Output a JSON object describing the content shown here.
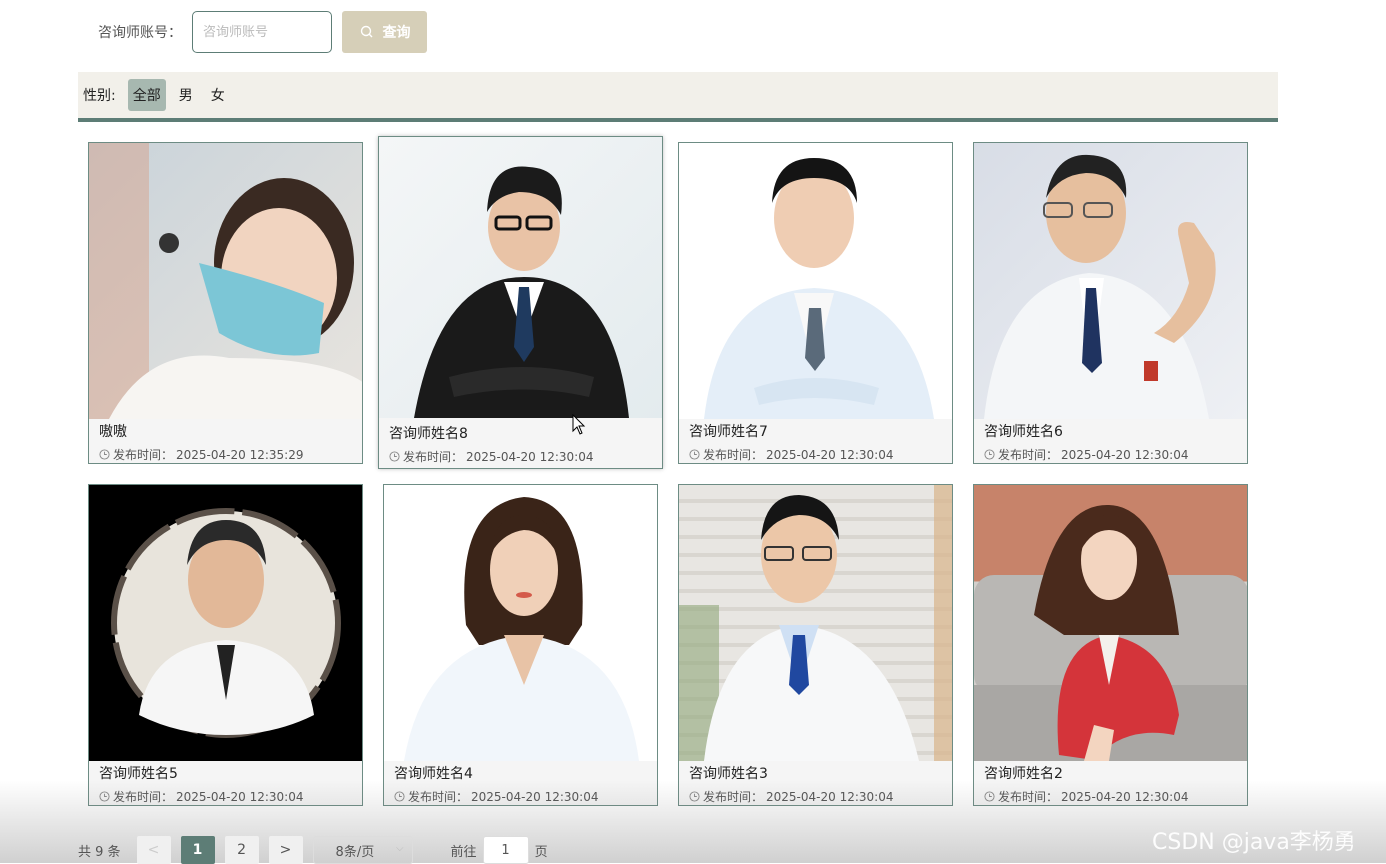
{
  "search": {
    "label": "咨询师账号：",
    "placeholder": "咨询师账号",
    "value": "",
    "button_label": "查询"
  },
  "filter": {
    "label": "性别:",
    "options": [
      "全部",
      "男",
      "女"
    ],
    "selected": "全部"
  },
  "cards": [
    {
      "name": "嗷嗷",
      "time_label": "发布时间：",
      "time": "2025-04-20 12:35:29"
    },
    {
      "name": "咨询师姓名8",
      "time_label": "发布时间：",
      "time": "2025-04-20 12:30:04"
    },
    {
      "name": "咨询师姓名7",
      "time_label": "发布时间：",
      "time": "2025-04-20 12:30:04"
    },
    {
      "name": "咨询师姓名6",
      "time_label": "发布时间：",
      "time": "2025-04-20 12:30:04"
    },
    {
      "name": "咨询师姓名5",
      "time_label": "发布时间：",
      "time": "2025-04-20 12:30:04"
    },
    {
      "name": "咨询师姓名4",
      "time_label": "发布时间：",
      "time": "2025-04-20 12:30:04"
    },
    {
      "name": "咨询师姓名3",
      "time_label": "发布时间：",
      "time": "2025-04-20 12:30:04"
    },
    {
      "name": "咨询师姓名2",
      "time_label": "发布时间：",
      "time": "2025-04-20 12:30:04"
    }
  ],
  "pagination": {
    "total": "共 9 条",
    "prev": "<",
    "pages": [
      "1",
      "2"
    ],
    "current": "1",
    "next": ">",
    "page_size": "8条/页",
    "goto_label": "前往",
    "goto_value": "1",
    "goto_suffix": "页"
  },
  "watermark": "CSDN @java李杨勇",
  "colors": {
    "accent": "#5d7d76",
    "button": "#d6cfb8",
    "filter_bg": "#f2f0ea",
    "active_chip": "#a7b8b0"
  }
}
